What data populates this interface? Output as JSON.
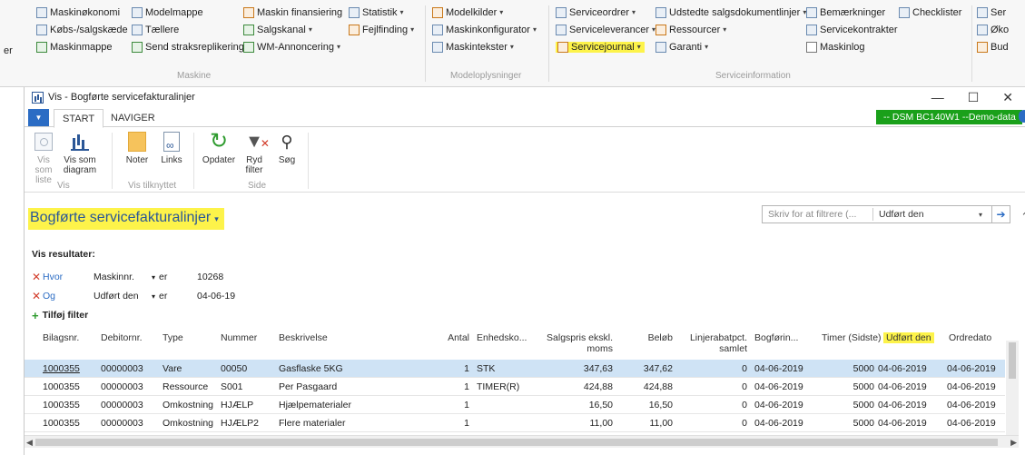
{
  "ribbon": {
    "col1": [
      "Maskinøkonomi",
      "Købs-/salgskæde",
      "Maskinmappe"
    ],
    "col2": [
      "Modelmappe",
      "Tællere",
      "Send straksreplikering"
    ],
    "col3": [
      "Maskin finansiering",
      "Salgskanal",
      "WM-Annoncering"
    ],
    "col4": [
      "Statistik",
      "Fejlfinding"
    ],
    "col5": [
      "Modelkilder",
      "Maskinkonfigurator",
      "Maskintekster"
    ],
    "col6": [
      "Serviceordrer",
      "Serviceleverancer",
      "Servicejournal"
    ],
    "col7": [
      "Udstedte salgsdokumentlinjer",
      "Ressourcer",
      "Garanti"
    ],
    "col8": [
      "Bemærkninger",
      "Servicekontrakter",
      "Maskinlog"
    ],
    "col9": [
      "Checklister"
    ],
    "col10": [
      "Ser",
      "Øko",
      "Bud"
    ],
    "prefix_er": "er",
    "group_maskine": "Maskine",
    "group_model": "Modeloplysninger",
    "group_service": "Serviceinformation"
  },
  "window": {
    "title": "Vis - Bogførte servicefakturalinjer",
    "minimize": "—",
    "maximize": "☐",
    "close": "✕"
  },
  "tabs": {
    "start": "START",
    "navigate": "NAVIGER",
    "company": "-- DSM BC140W1 --Demo-data"
  },
  "commands": {
    "list_view": "Vis som\nliste",
    "chart_view": "Vis som\ndiagram",
    "notes": "Noter",
    "links": "Links",
    "refresh": "Opdater",
    "clear_filter": "Ryd\nfilter",
    "find": "Søg",
    "group_view": "Vis",
    "group_attached": "Vis tilknyttet",
    "group_page": "Side"
  },
  "page": {
    "title": "Bogførte servicefakturalinjer",
    "filter_placeholder": "Skriv for at filtrere (...",
    "filter_field": "Udført den"
  },
  "filters": {
    "header": "Vis resultater:",
    "rows": [
      {
        "keyword": "Hvor",
        "field": "Maskinnr.",
        "op": "er",
        "value": "10268"
      },
      {
        "keyword": "Og",
        "field": "Udført den",
        "op": "er",
        "value": "04-06-19"
      }
    ],
    "add": "Tilføj filter"
  },
  "table": {
    "headers": {
      "bilagsnr": "Bilagsnr.",
      "debitornr": "Debitornr.",
      "type": "Type",
      "nummer": "Nummer",
      "beskrivelse": "Beskrivelse",
      "antal": "Antal",
      "enhed": "Enhedsko...",
      "salgspris": "Salgspris ekskl.\nmoms",
      "beloeb": "Beløb",
      "rabat": "Linjerabatpct.\nsamlet",
      "bogfoering": "Bogførin...",
      "timer": "Timer (Sidste)",
      "udfoert": "Udført den",
      "ordredato": "Ordredato"
    },
    "rows": [
      {
        "bilagsnr": "1000355",
        "debitornr": "00000003",
        "type": "Vare",
        "nummer": "00050",
        "beskrivelse": "Gasflaske 5KG",
        "antal": "1",
        "enhed": "STK",
        "salgspris": "347,63",
        "beloeb": "347,62",
        "rabat": "0",
        "bogfoering": "04-06-2019",
        "timer": "5000",
        "udfoert": "04-06-2019",
        "ordredato": "04-06-2019"
      },
      {
        "bilagsnr": "1000355",
        "debitornr": "00000003",
        "type": "Ressource",
        "nummer": "S001",
        "beskrivelse": "Per Pasgaard",
        "antal": "1",
        "enhed": "TIMER(R)",
        "salgspris": "424,88",
        "beloeb": "424,88",
        "rabat": "0",
        "bogfoering": "04-06-2019",
        "timer": "5000",
        "udfoert": "04-06-2019",
        "ordredato": "04-06-2019"
      },
      {
        "bilagsnr": "1000355",
        "debitornr": "00000003",
        "type": "Omkostning",
        "nummer": "HJÆLP",
        "beskrivelse": "Hjælpematerialer",
        "antal": "1",
        "enhed": "",
        "salgspris": "16,50",
        "beloeb": "16,50",
        "rabat": "0",
        "bogfoering": "04-06-2019",
        "timer": "5000",
        "udfoert": "04-06-2019",
        "ordredato": "04-06-2019"
      },
      {
        "bilagsnr": "1000355",
        "debitornr": "00000003",
        "type": "Omkostning",
        "nummer": "HJÆLP2",
        "beskrivelse": "Flere materialer",
        "antal": "1",
        "enhed": "",
        "salgspris": "11,00",
        "beloeb": "11,00",
        "rabat": "0",
        "bogfoering": "04-06-2019",
        "timer": "5000",
        "udfoert": "04-06-2019",
        "ordredato": "04-06-2019"
      }
    ]
  },
  "colors": {
    "highlight": "#fdf34a",
    "accent": "#2b6cc4",
    "company_badge": "#1aa01a",
    "selected_row": "#cfe3f5"
  }
}
